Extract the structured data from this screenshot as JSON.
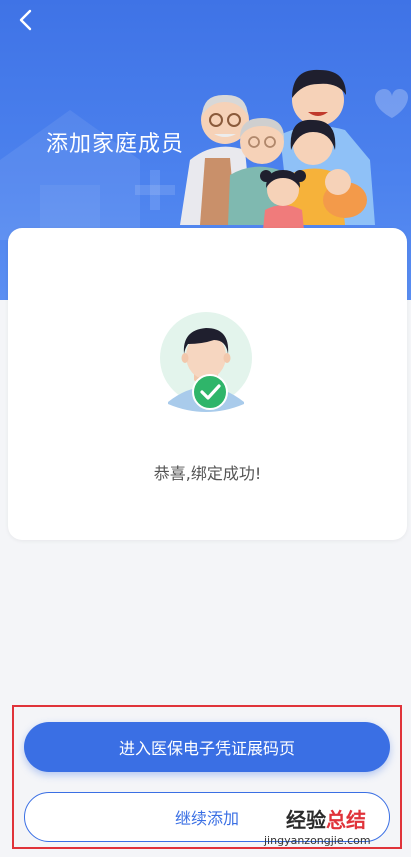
{
  "header": {
    "title": "添加家庭成员",
    "background_color": "#4277e8"
  },
  "result_card": {
    "message": "恭喜,绑定成功!",
    "status_icon": "check-icon",
    "status_color": "#2fb56a"
  },
  "actions": {
    "primary_label": "进入医保电子凭证展码页",
    "secondary_label": "继续添加",
    "accent_color": "#3a6fe4"
  },
  "watermark": {
    "main_part1": "经验",
    "main_part2": "总结",
    "sub": "jingyanzongjie.com"
  }
}
